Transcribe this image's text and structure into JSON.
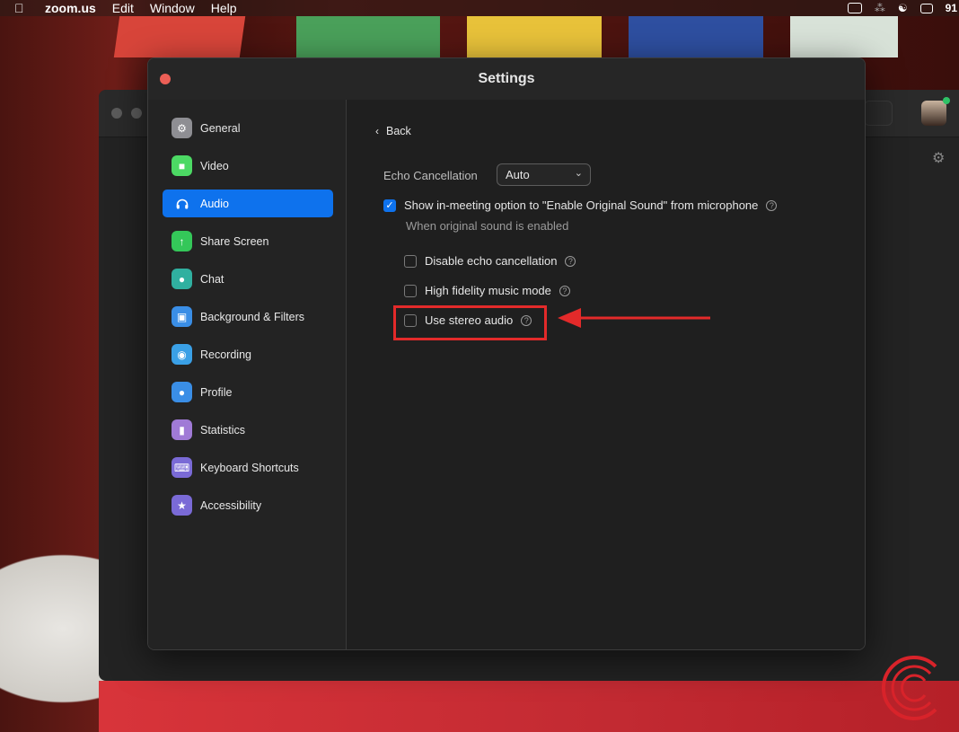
{
  "menubar": {
    "app_name": "zoom.us",
    "items": [
      "Edit",
      "Window",
      "Help"
    ],
    "battery": "91"
  },
  "settings": {
    "title": "Settings",
    "sidebar": {
      "items": [
        {
          "label": "General",
          "icon": "gear-icon",
          "color": "#8e8e93"
        },
        {
          "label": "Video",
          "icon": "video-camera-icon",
          "color": "#4cd964"
        },
        {
          "label": "Audio",
          "icon": "headphones-icon",
          "color": "#0e72ed",
          "active": true
        },
        {
          "label": "Share Screen",
          "icon": "share-screen-icon",
          "color": "#34c759"
        },
        {
          "label": "Chat",
          "icon": "chat-bubble-icon",
          "color": "#30b0a0"
        },
        {
          "label": "Background & Filters",
          "icon": "background-icon",
          "color": "#3a8ee6"
        },
        {
          "label": "Recording",
          "icon": "recording-icon",
          "color": "#3aa0e6"
        },
        {
          "label": "Profile",
          "icon": "profile-icon",
          "color": "#3a8ee6"
        },
        {
          "label": "Statistics",
          "icon": "statistics-icon",
          "color": "#a07ad6"
        },
        {
          "label": "Keyboard Shortcuts",
          "icon": "keyboard-icon",
          "color": "#7a6ad6"
        },
        {
          "label": "Accessibility",
          "icon": "accessibility-icon",
          "color": "#7a6ad6"
        }
      ]
    },
    "content": {
      "back_label": "Back",
      "echo_cancellation_label": "Echo Cancellation",
      "echo_cancellation_value": "Auto",
      "original_sound_option": {
        "label": "Show in-meeting option to \"Enable Original Sound\" from microphone",
        "checked": true
      },
      "original_sound_subheading": "When original sound is enabled",
      "sub_options": [
        {
          "label": "Disable echo cancellation",
          "checked": false
        },
        {
          "label": "High fidelity music mode",
          "checked": false
        },
        {
          "label": "Use stereo audio",
          "checked": false
        }
      ]
    }
  },
  "colors": {
    "accent": "#0e72ed",
    "annotation": "#e32a2a"
  }
}
